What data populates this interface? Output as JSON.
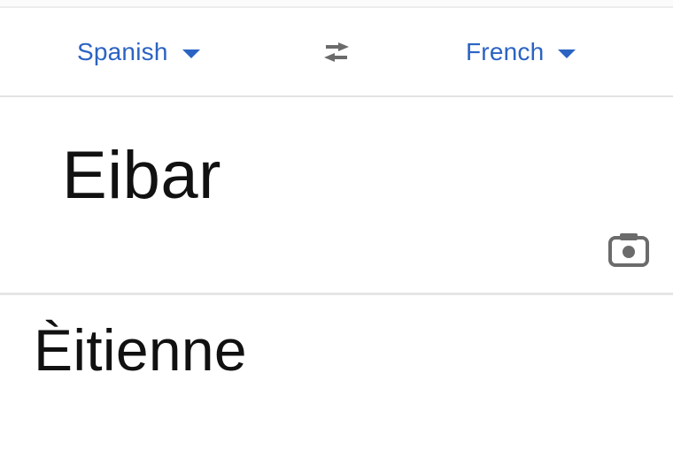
{
  "languages": {
    "source": "Spanish",
    "target": "French"
  },
  "icons": {
    "source_caret": "caret-down-icon",
    "target_caret": "caret-down-icon",
    "swap": "swap-arrows-icon",
    "camera": "camera-icon"
  },
  "colors": {
    "accent": "#2b63c3",
    "icon_gray": "#6b6b6b",
    "text": "#111111"
  },
  "input": {
    "text": "Eibar"
  },
  "result": {
    "text": "Èitienne"
  }
}
